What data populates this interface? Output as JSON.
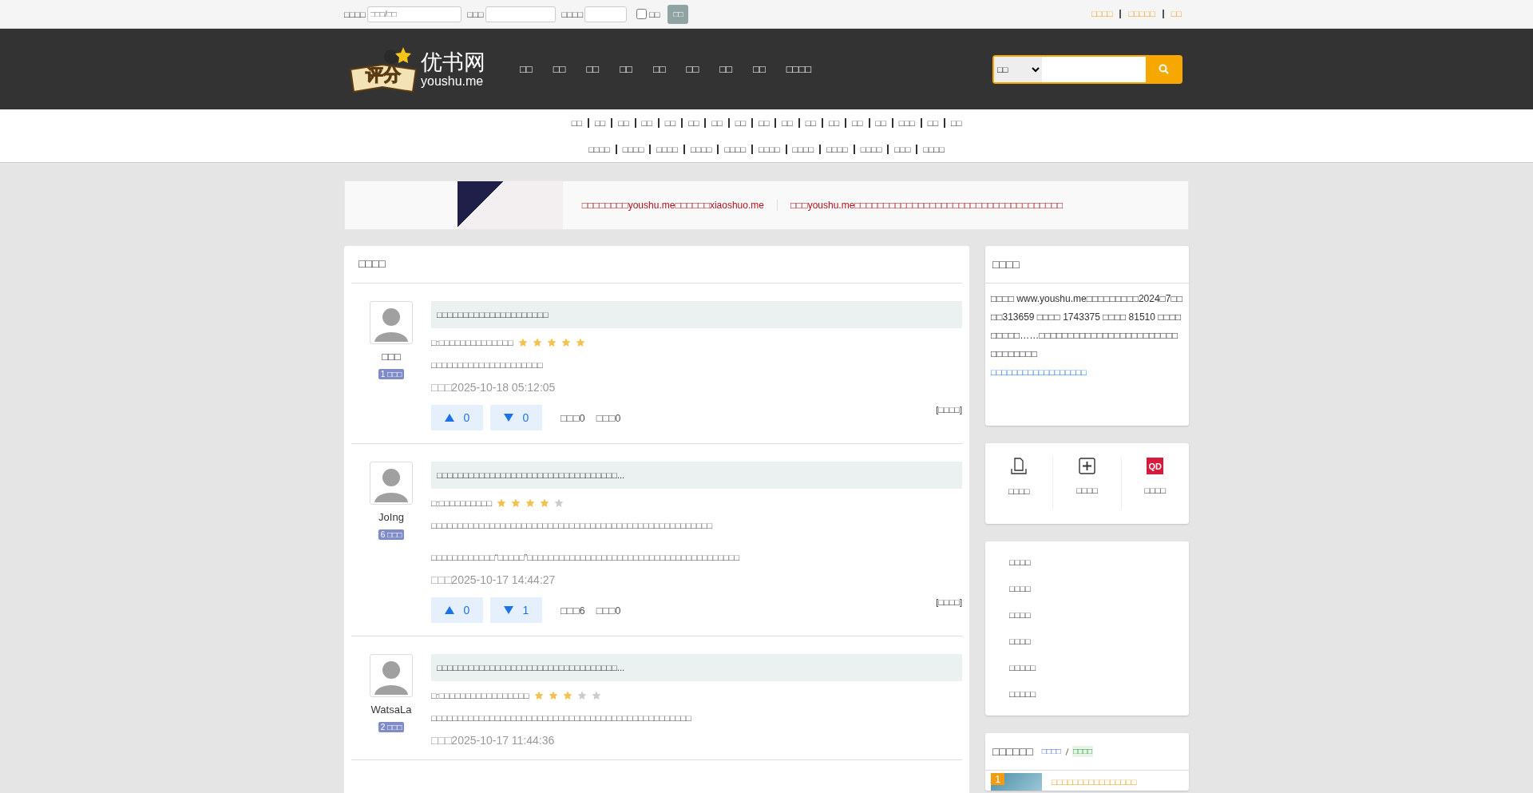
{
  "top_bar": {
    "fields": [
      {
        "label": "□□□□",
        "placeholder": "□□□/□□"
      },
      {
        "label": "□□□"
      },
      {
        "label": "□□□□"
      }
    ],
    "checkbox": {
      "label": "□□",
      "checked": false
    },
    "button": "□□",
    "links": [
      "□□□□",
      "□□□□□",
      "□□"
    ]
  },
  "header": {
    "logo": {
      "badge": "评分",
      "name": "优书网",
      "domain": "youshu.me"
    },
    "nav": [
      "□□",
      "□□",
      "□□",
      "□□",
      "□□",
      "□□",
      "□□",
      "□□",
      "□□□□"
    ],
    "search": {
      "scope": "□□"
    }
  },
  "categories": {
    "row_1": [
      "□□",
      "□□",
      "□□",
      "□□",
      "□□",
      "□□",
      "□□",
      "□□",
      "□□",
      "□□",
      "□□",
      "□□",
      "□□",
      "□□",
      "□□□",
      "□□",
      "□□"
    ],
    "row_2": [
      "□□□□",
      "□□□□",
      "□□□□",
      "□□□□",
      "□□□□",
      "□□□□",
      "□□□□",
      "□□□□",
      "□□□□",
      "□□□",
      "□□□□"
    ]
  },
  "banner": {
    "notices": [
      "□□□□□□□□youshu.me□□□□□□xiaoshuo.me",
      "□□□youshu.me□□□□□□□□□□□□□□□□□□□□□□□□□□□□□□□□□□□□"
    ]
  },
  "reviews": {
    "title": "□□□□",
    "items": [
      {
        "user": "□□□",
        "level": "1 □□□",
        "title": "□□□□□□□□□□□□□□□□□□□□□",
        "rating_label": "□:□□□□□□□□□□□□□□",
        "stars": 5,
        "paragraphs": [
          "□□□□□□□□□□□□□□□□□□□□□"
        ],
        "time": "□□□2025-10-18 05:12:05",
        "up": "0",
        "down": "0",
        "stats": [
          "□□□0",
          "□□□0"
        ],
        "link": "[□□□□]"
      },
      {
        "user": "JoIng",
        "level": "6 □□□",
        "title": "□□□□□□□□□□□□□□□□□□□□□□□□□□□□□□□□□□...",
        "rating_label": "□:□□□□□□□□□□",
        "stars": 4,
        "paragraphs": [
          "□□□□□□□□□□□□□□□□□□□□□□□□□□□□□□□□□□□□□□□□□□□□□□□□□□□□□",
          "□□□□□□□□□□□□“□□□□□”□□□□□□□□□□□□□□□□□□□□□□□□□□□□□□□□□□□□□□□□"
        ],
        "time": "□□□2025-10-17 14:44:27",
        "up": "0",
        "down": "1",
        "stats": [
          "□□□6",
          "□□□0"
        ],
        "link": "[□□□□]"
      },
      {
        "user": "WatsaLa",
        "level": "2 □□□",
        "title": "□□□□□□□□□□□□□□□□□□□□□□□□□□□□□□□□□□...",
        "rating_label": "□:□□□□□□□□□□□□□□□□□",
        "stars": 3,
        "paragraphs": [
          "□□□□□□□□□□□□□□□□□□□□□□□□□□□□□□□□□□□□□□□□□□□□□□□□□"
        ],
        "time": "□□□2025-10-17 11:44:36"
      }
    ]
  },
  "sidebar": {
    "about": {
      "title": "□□□□",
      "text": "□□□□ www.youshu.me□□□□□□□□□2024□7□□□□313659 □□□□ 1743375 □□□□ 81510 □□□□□□□□□……□□□□□□□□□□□□□□□□□□□□□□□□□□□□□□□□",
      "link": "□□□□□□□□□□□□□□□□□□"
    },
    "actions": [
      {
        "kind": "copy",
        "label": "□□□□"
      },
      {
        "kind": "plus",
        "label": "□□□□"
      },
      {
        "kind": "qd",
        "label": "□□□□",
        "logo_text": "QD"
      }
    ],
    "links": [
      "□□□□",
      "□□□□",
      "□□□□",
      "□□□□",
      "□□□□□",
      "□□□□□"
    ],
    "ranking": {
      "title": "□□□□□□",
      "tabs": [
        {
          "label": "□□□□",
          "selected": false
        },
        {
          "label": "□□□□",
          "selected": true
        }
      ],
      "items": [
        {
          "rank": "1",
          "title": "□□□□□□□□□□□□□□□□"
        }
      ]
    }
  }
}
